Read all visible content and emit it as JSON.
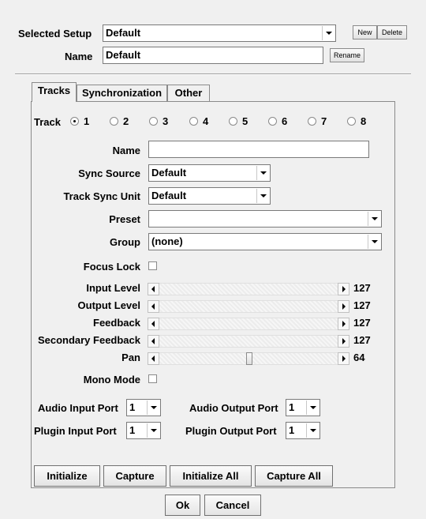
{
  "setup": {
    "selected_label": "Selected Setup",
    "selected_value": "Default",
    "new_label": "New",
    "delete_label": "Delete",
    "name_label": "Name",
    "name_value": "Default",
    "rename_label": "Rename"
  },
  "tabs": [
    {
      "label": "Tracks",
      "active": true
    },
    {
      "label": "Synchronization",
      "active": false
    },
    {
      "label": "Other",
      "active": false
    }
  ],
  "track": {
    "label": "Track",
    "options": [
      "1",
      "2",
      "3",
      "4",
      "5",
      "6",
      "7",
      "8"
    ],
    "selected": "1"
  },
  "fields": {
    "name_label": "Name",
    "name_value": "",
    "sync_source_label": "Sync Source",
    "sync_source_value": "Default",
    "track_sync_unit_label": "Track Sync Unit",
    "track_sync_unit_value": "Default",
    "preset_label": "Preset",
    "preset_value": "",
    "group_label": "Group",
    "group_value": "(none)",
    "focus_lock_label": "Focus Lock",
    "focus_lock_checked": false,
    "mono_mode_label": "Mono Mode",
    "mono_mode_checked": false
  },
  "sliders": [
    {
      "label": "Input Level",
      "value": "127",
      "max": 127
    },
    {
      "label": "Output Level",
      "value": "127",
      "max": 127
    },
    {
      "label": "Feedback",
      "value": "127",
      "max": 127
    },
    {
      "label": "Secondary Feedback",
      "value": "127",
      "max": 127
    },
    {
      "label": "Pan",
      "value": "64",
      "max": 127
    }
  ],
  "ports": {
    "audio_input_label": "Audio Input Port",
    "audio_input_value": "1",
    "audio_output_label": "Audio Output Port",
    "audio_output_value": "1",
    "plugin_input_label": "Plugin Input Port",
    "plugin_input_value": "1",
    "plugin_output_label": "Plugin Output Port",
    "plugin_output_value": "1"
  },
  "actions": {
    "initialize": "Initialize",
    "capture": "Capture",
    "initialize_all": "Initialize All",
    "capture_all": "Capture All"
  },
  "dialog": {
    "ok": "Ok",
    "cancel": "Cancel"
  }
}
